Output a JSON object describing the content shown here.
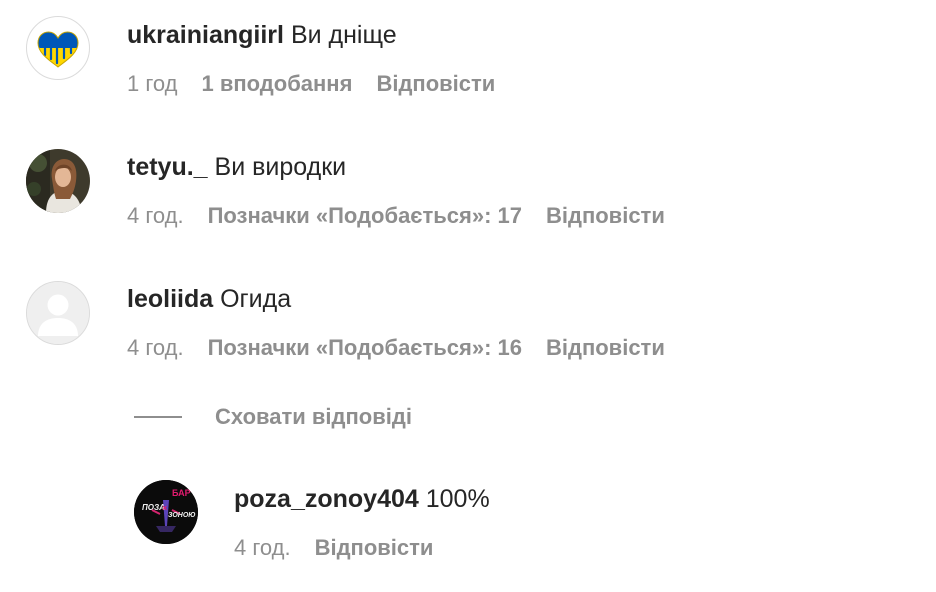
{
  "comments": [
    {
      "username": "ukrainiangiirl",
      "text": "Ви дніще",
      "time": "1 год",
      "likes": "1 вподобання",
      "reply": "Відповісти",
      "avatar_icon": "heart-ukraine-flag-icon"
    },
    {
      "username": "tetyu._",
      "text": "Ви виродки",
      "time": "4 год.",
      "likes": "Позначки «Подобається»: 17",
      "reply": "Відповісти",
      "avatar_icon": "profile-photo"
    },
    {
      "username": "leoliida",
      "text": "Огида",
      "time": "4 год.",
      "likes": "Позначки «Подобається»: 16",
      "reply": "Відповісти",
      "avatar_icon": "default-avatar-icon"
    }
  ],
  "hide_replies": "Сховати відповіді",
  "replies": [
    {
      "username": "poza_zonoy404",
      "text": "100%",
      "time": "4 год.",
      "reply": "Відповісти",
      "avatar_icon": "bar-logo",
      "avatar_logo_text": [
        "ПОЗА",
        "БАР",
        "ЗОНОЮ"
      ]
    }
  ],
  "colors": {
    "text_primary": "#262626",
    "text_secondary": "#8e8e8e",
    "ukraine_blue": "#0057b7",
    "ukraine_yellow": "#ffd700"
  }
}
